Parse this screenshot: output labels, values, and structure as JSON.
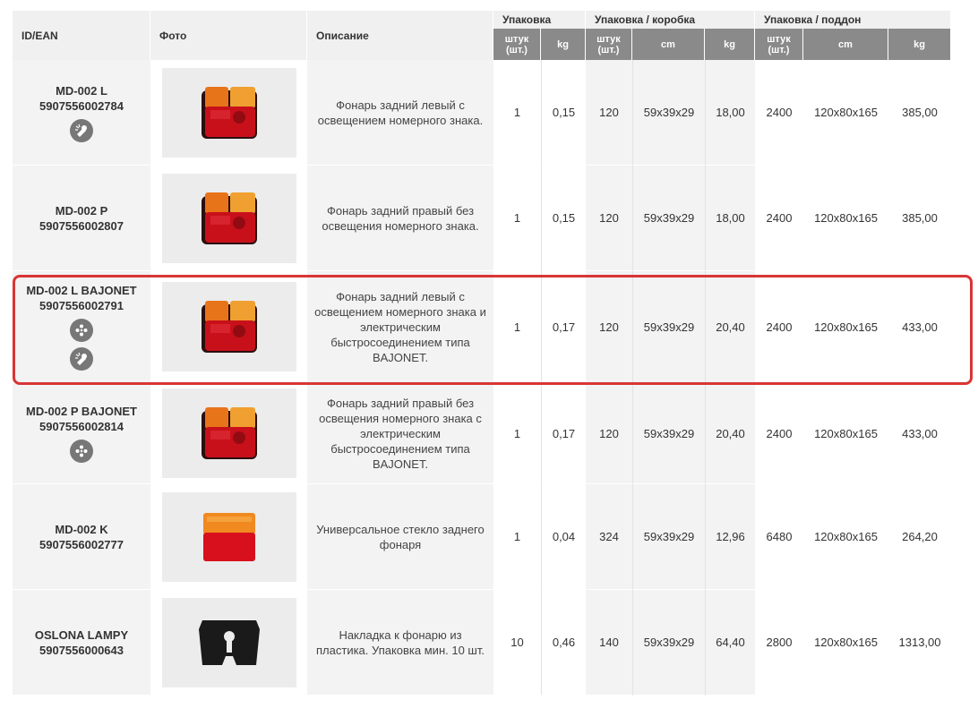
{
  "headers": {
    "id": "ID/EAN",
    "photo": "Фото",
    "desc": "Описание",
    "grp_pack": "Упаковка",
    "grp_box": "Упаковка / коробка",
    "grp_pallet": "Упаковка / поддон",
    "pcs": "штук (шт.)",
    "kg": "kg",
    "cm": "cm"
  },
  "colors": {
    "highlight": "#d93535",
    "subheader": "#8a8a8a",
    "icon": "#777777"
  },
  "rows": [
    {
      "code": "MD-002 L",
      "ean": "5907556002784",
      "icons": [
        "lamp-icon"
      ],
      "photo": "tail-lamp",
      "desc": "Фонарь задний левый с освещением номерного знака.",
      "pack_pcs": "1",
      "pack_kg": "0,15",
      "box_pcs": "120",
      "box_cm": "59x39x29",
      "box_kg": "18,00",
      "pal_pcs": "2400",
      "pal_cm": "120x80x165",
      "pal_kg": "385,00"
    },
    {
      "code": "MD-002 P",
      "ean": "5907556002807",
      "icons": [],
      "photo": "tail-lamp",
      "desc": "Фонарь задний правый без освещения номерного знака.",
      "pack_pcs": "1",
      "pack_kg": "0,15",
      "box_pcs": "120",
      "box_cm": "59x39x29",
      "box_kg": "18,00",
      "pal_pcs": "2400",
      "pal_cm": "120x80x165",
      "pal_kg": "385,00"
    },
    {
      "code": "MD-002 L BAJONET",
      "ean": "5907556002791",
      "icons": [
        "connector-icon",
        "lamp-icon"
      ],
      "photo": "tail-lamp",
      "desc": "Фонарь задний левый с освещением номерного знака и электрическим быстросоединением типа BAJONET.",
      "pack_pcs": "1",
      "pack_kg": "0,17",
      "box_pcs": "120",
      "box_cm": "59x39x29",
      "box_kg": "20,40",
      "pal_pcs": "2400",
      "pal_cm": "120x80x165",
      "pal_kg": "433,00"
    },
    {
      "code": "MD-002 P BAJONET",
      "ean": "5907556002814",
      "icons": [
        "connector-icon"
      ],
      "photo": "tail-lamp",
      "desc": "Фонарь задний правый без освещения номерного знака с электрическим быстросоединением типа BAJONET.",
      "pack_pcs": "1",
      "pack_kg": "0,17",
      "box_pcs": "120",
      "box_cm": "59x39x29",
      "box_kg": "20,40",
      "pal_pcs": "2400",
      "pal_cm": "120x80x165",
      "pal_kg": "433,00"
    },
    {
      "code": "MD-002 K",
      "ean": "5907556002777",
      "icons": [],
      "photo": "lamp-glass",
      "desc": "Универсальное стекло заднего фонаря",
      "pack_pcs": "1",
      "pack_kg": "0,04",
      "box_pcs": "324",
      "box_cm": "59x39x29",
      "box_kg": "12,96",
      "pal_pcs": "6480",
      "pal_cm": "120x80x165",
      "pal_kg": "264,20"
    },
    {
      "code": "OSLONA LAMPY",
      "ean": "5907556000643",
      "icons": [],
      "photo": "lamp-cover",
      "desc": "Накладка к фонарю из пластика. Упаковка мин. 10 шт.",
      "pack_pcs": "10",
      "pack_kg": "0,46",
      "box_pcs": "140",
      "box_cm": "59x39x29",
      "box_kg": "64,40",
      "pal_pcs": "2800",
      "pal_cm": "120x80x165",
      "pal_kg": "1313,00"
    }
  ]
}
